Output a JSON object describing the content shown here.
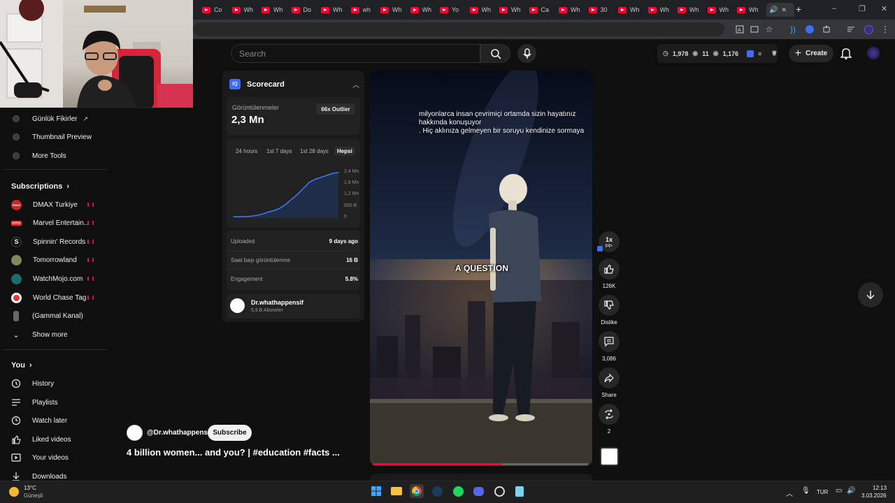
{
  "browser": {
    "tabs": [
      {
        "title": "Co"
      },
      {
        "title": "Wh"
      },
      {
        "title": "Wh"
      },
      {
        "title": "Do"
      },
      {
        "title": "Wh"
      },
      {
        "title": "wh"
      },
      {
        "title": "Wh"
      },
      {
        "title": "Wh"
      },
      {
        "title": "Yo"
      },
      {
        "title": "Wh"
      },
      {
        "title": "Wh"
      },
      {
        "title": "Ca"
      },
      {
        "title": "Wh"
      },
      {
        "title": "30"
      },
      {
        "title": "Wh"
      },
      {
        "title": "Wh"
      },
      {
        "title": "Wh"
      },
      {
        "title": "Wh"
      },
      {
        "title": "Wh"
      }
    ],
    "new_tab": "+",
    "window_controls": {
      "minimize": "–",
      "restore": "❐",
      "close": "✕"
    }
  },
  "header": {
    "search_placeholder": "Search",
    "stats": {
      "clock": "1,978",
      "eye1": "11",
      "eye2": "1,176"
    },
    "create_label": "Create"
  },
  "sidebar": {
    "tools": [
      {
        "label": "Günlük Fikirler",
        "external": true
      },
      {
        "label": "Thumbnail Preview"
      },
      {
        "label": "More Tools"
      }
    ],
    "subscriptions_heading": "Subscriptions",
    "subscriptions": [
      {
        "name": "DMAX Turkiye",
        "avatar_color": "#c62828",
        "avatar_text": "DMAX"
      },
      {
        "name": "Marvel Entertain...",
        "avatar_color": "#e53935",
        "avatar_text": "MARVEL"
      },
      {
        "name": "Spinnin' Records",
        "avatar_color": "#111111",
        "avatar_text": "S"
      },
      {
        "name": "Tomorrowland",
        "avatar_color": "#7d8a5a",
        "avatar_text": ""
      },
      {
        "name": "WatchMojo.com",
        "avatar_color": "#1e6b6b",
        "avatar_text": ""
      },
      {
        "name": "World Chase Tag",
        "avatar_color": "#e53935",
        "avatar_text": ""
      },
      {
        "name": "(Gammal Kanal)",
        "avatar_color": "#666666",
        "avatar_text": ""
      }
    ],
    "show_more": "Show more",
    "you_heading": "You",
    "you_items": [
      {
        "label": "History",
        "icon": "history-icon"
      },
      {
        "label": "Playlists",
        "icon": "playlists-icon"
      },
      {
        "label": "Watch later",
        "icon": "watch-later-icon"
      },
      {
        "label": "Liked videos",
        "icon": "liked-videos-icon"
      },
      {
        "label": "Your videos",
        "icon": "your-videos-icon"
      },
      {
        "label": "Downloads",
        "icon": "downloads-icon"
      }
    ]
  },
  "scorecard": {
    "badge": "IQ",
    "title": "Scorecard",
    "views_label": "Görüntülenmeler",
    "views_value": "2,3 Mn",
    "outlier": "66x Outlier",
    "ranges": [
      "24 hours",
      "1st 7 days",
      "1st 28 days",
      "Hepsi"
    ],
    "selected_range": "Hepsi",
    "metrics": [
      {
        "label": "Uploaded",
        "value": "9 days ago"
      },
      {
        "label": "Saat başı görüntülenme",
        "value": "16 B"
      },
      {
        "label": "Engagement",
        "value": "5.8%"
      }
    ],
    "channel_name": "Dr.whathappensif",
    "channel_subs": "5,9 B Aboneler"
  },
  "chart_data": {
    "type": "line",
    "title": "",
    "xlabel": "",
    "ylabel": "",
    "y_tick_labels": [
      "2,4 Mn",
      "1,8 Mn",
      "1,2 Mn",
      "600 B",
      "0"
    ],
    "ylim": [
      0,
      2400000
    ],
    "series": [
      {
        "values": [
          60000,
          60000,
          70000,
          90000,
          130000,
          200000,
          300000,
          380000,
          500000,
          700000,
          950000,
          1200000,
          1500000,
          1800000,
          1950000,
          2050000,
          2150000,
          2250000,
          2300000
        ]
      }
    ]
  },
  "video": {
    "caption_lines": [
      "milyonlarca insan çevrimiçi ortamda sizin hayatınız",
      "hakkında konuşuyor",
      ".  Hiç aklınıza gelmeyen bir soruyu kendinize sormaya"
    ],
    "overlay_text": "A QUESTION",
    "progress_fraction": 0.6
  },
  "actions": {
    "speed": "1x",
    "like_count": "126K",
    "dislike_label": "Dislike",
    "comment_count": "3,086",
    "share_label": "Share",
    "remix_count": "2"
  },
  "channel": {
    "handle": "@Dr.whathappensif",
    "subscribe_label": "Subscribe",
    "video_title": "4 billion women... and you? | #education #facts ..."
  },
  "taskbar": {
    "weather_temp": "13°C",
    "weather_desc": "Güneşli",
    "language": "TUR",
    "time": "12:13",
    "date": "3.03.2026"
  }
}
